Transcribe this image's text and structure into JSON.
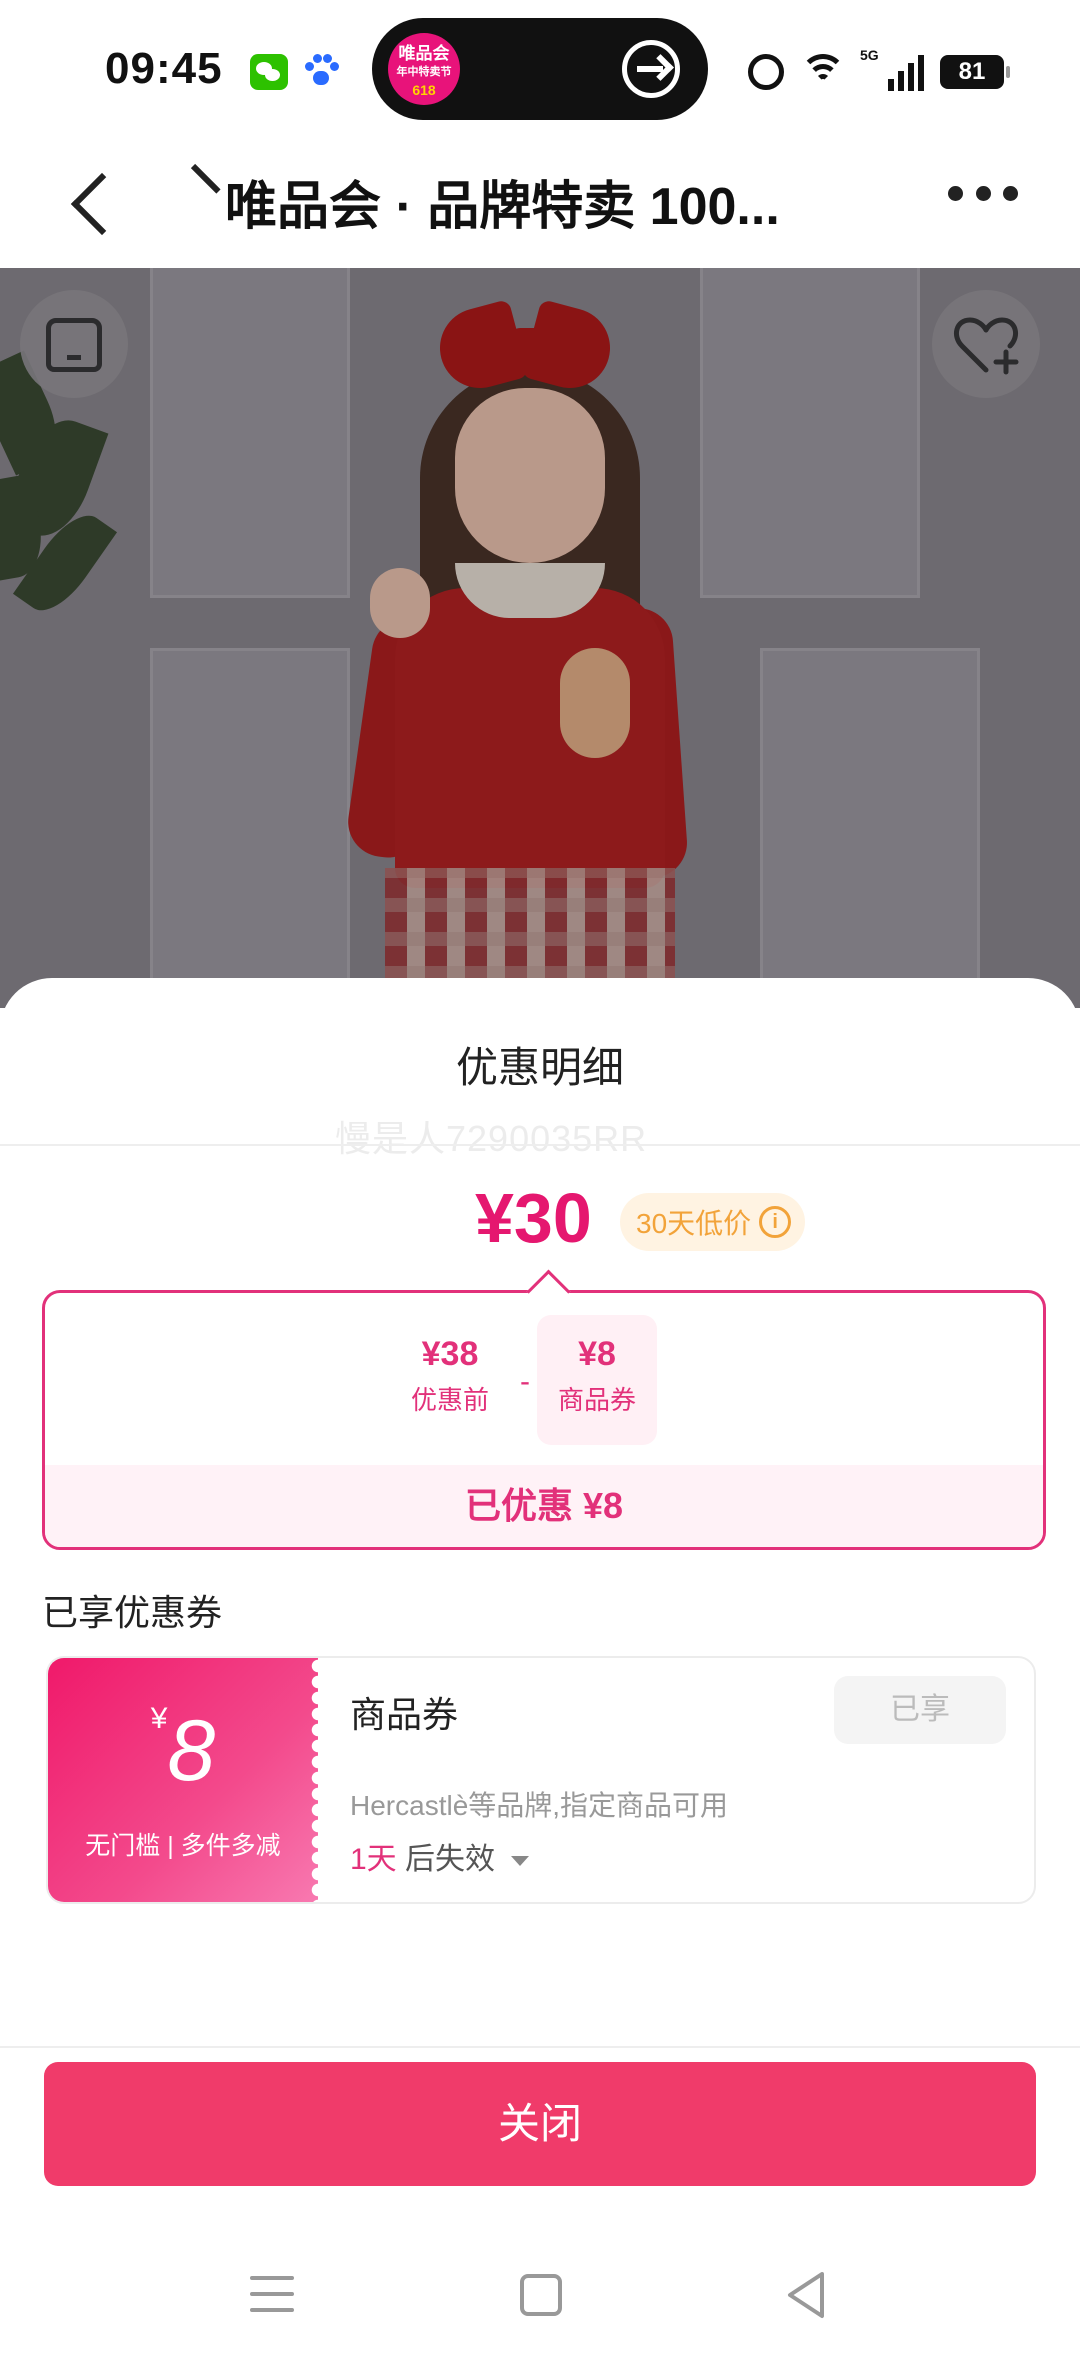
{
  "status_bar": {
    "time": "09:45",
    "battery": "81",
    "network": "5G"
  },
  "pill_logo": {
    "line1": "唯品会",
    "line2": "年中特卖节",
    "line3": "618"
  },
  "nav": {
    "title": "唯品会 · 品牌特卖 100..."
  },
  "sheet": {
    "title": "优惠明细",
    "watermark": "慢是人7290035RR",
    "final_price": "¥30",
    "low_price_badge": "30天低价",
    "calc": {
      "before_value": "¥38",
      "before_label": "优惠前",
      "minus": "-",
      "coupon_value": "¥8",
      "coupon_label": "商品券",
      "saved": "已优惠 ¥8"
    },
    "section_label": "已享优惠券",
    "coupon": {
      "currency": "¥",
      "amount": "8",
      "condition": "无门槛 | 多件多减",
      "name": "商品券",
      "status": "已享",
      "description": "Hercastlè等品牌,指定商品可用",
      "expire_days": "1天",
      "expire_suffix": "后失效"
    },
    "close_label": "关闭"
  },
  "colors": {
    "accent": "#e5176f",
    "close_button": "#f03b6a",
    "badge_text": "#f2a33a"
  }
}
